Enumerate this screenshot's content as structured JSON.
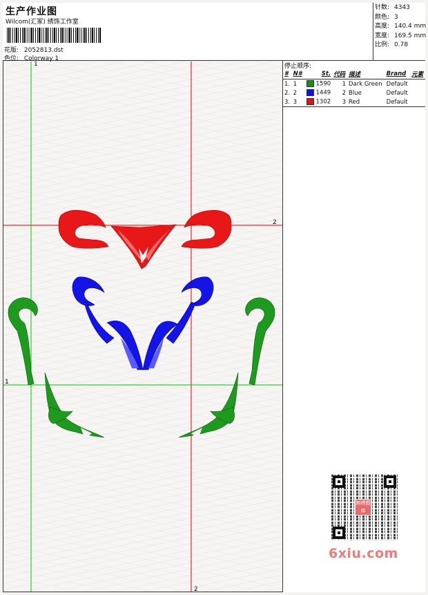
{
  "header": {
    "title": "生产作业图",
    "company": "Wilcom(汇冢) 绣饰工作室",
    "design_label": "花版:",
    "design_value": "2052813.dst",
    "colorway_label": "色位:",
    "colorway_value": "Colorway 1"
  },
  "stats": [
    {
      "label": "针数:",
      "value": "4343"
    },
    {
      "label": "颜色:",
      "value": "3"
    },
    {
      "label": "高度:",
      "value": "140.4 mm"
    },
    {
      "label": "宽度:",
      "value": "169.5 mm"
    },
    {
      "label": "比例:",
      "value": "0.78"
    }
  ],
  "stop_sequence": {
    "title": "停止顺序:",
    "columns": [
      "#",
      "N#",
      "St.",
      "代码",
      "描述",
      "Brand",
      "元素"
    ],
    "rows": [
      {
        "idx": "1.",
        "n": "1",
        "stitches": "1590",
        "code": "1",
        "desc": "Dark Green",
        "brand": "Default",
        "color": "#1a8a1a"
      },
      {
        "idx": "2.",
        "n": "2",
        "stitches": "1449",
        "code": "2",
        "desc": "Blue",
        "brand": "Default",
        "color": "#1212e0"
      },
      {
        "idx": "3.",
        "n": "3",
        "stitches": "1302",
        "code": "3",
        "desc": "Red",
        "brand": "Default",
        "color": "#e01212"
      }
    ]
  },
  "guides": {
    "green_v_label": "1",
    "green_h_label": "1",
    "red_h_label": "2",
    "red_v_label": "2"
  },
  "colors": {
    "green_guide": "#00c800",
    "red_guide": "#e00000"
  },
  "watermark": {
    "text": "6xiu.com",
    "qr_logo": "刺绣图库"
  }
}
